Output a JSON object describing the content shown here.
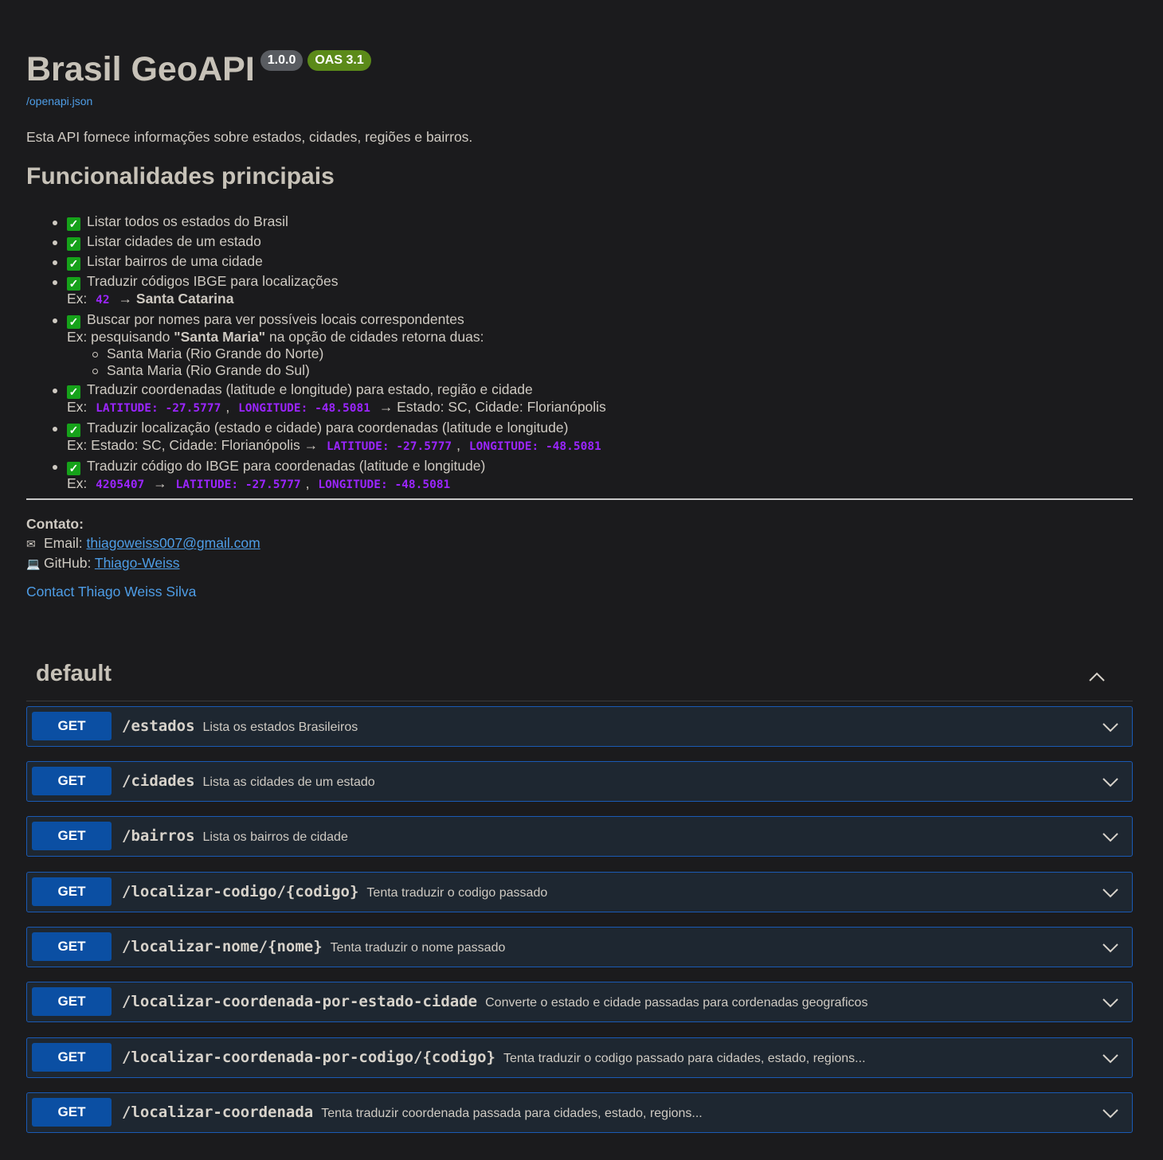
{
  "info": {
    "title": "Brasil GeoAPI",
    "version": "1.0.0",
    "oas": "OAS 3.1",
    "spec_link": "/openapi.json",
    "description": "Esta API fornece informações sobre estados, cidades, regiões e bairros."
  },
  "features": {
    "heading": "Funcionalidades principais",
    "items": [
      {
        "text": "Listar todos os estados do Brasil"
      },
      {
        "text": "Listar cidades de um estado"
      },
      {
        "text": "Listar bairros de uma cidade"
      },
      {
        "text": "Traduzir códigos IBGE para localizações",
        "ex_prefix": "Ex:",
        "ex_code": "42",
        "ex_arrow": "→",
        "ex_result": "Santa Catarina"
      },
      {
        "text": "Buscar por nomes para ver possíveis locais correspondentes",
        "ex_prefix": "Ex: pesquisando",
        "ex_term": "\"Santa Maria\"",
        "ex_suffix": "na opção de cidades retorna duas:",
        "subitems": [
          "Santa Maria (Rio Grande do Norte)",
          "Santa Maria (Rio Grande do Sul)"
        ]
      },
      {
        "text": "Traduzir coordenadas (latitude e longitude) para estado, região e cidade",
        "ex_prefix": "Ex:",
        "ex_lat": "LATITUDE: -27.5777",
        "ex_comma": ",",
        "ex_lon": "LONGITUDE: -48.5081",
        "ex_result": "→ Estado: SC, Cidade: Florianópolis"
      },
      {
        "text": "Traduzir localização (estado e cidade) para coordenadas (latitude e longitude)",
        "ex_prefix": "Ex: Estado: SC, Cidade: Florianópolis →",
        "ex_lat": "LATITUDE: -27.5777",
        "ex_comma": ",",
        "ex_lon": "LONGITUDE: -48.5081"
      },
      {
        "text": "Traduzir código do IBGE para coordenadas (latitude e longitude)",
        "ex_prefix": "Ex:",
        "ex_code": "4205407",
        "ex_arrow": "→",
        "ex_lat": "LATITUDE: -27.5777",
        "ex_comma": ",",
        "ex_lon": "LONGITUDE: -48.5081"
      }
    ]
  },
  "contact": {
    "heading": "Contato:",
    "email_label": "Email:",
    "email": "thiagoweiss007@gmail.com",
    "github_label": "GitHub:",
    "github": "Thiago-Weiss",
    "contact_link": "Contact Thiago Weiss Silva"
  },
  "section": {
    "name": "default"
  },
  "operations": [
    {
      "method": "GET",
      "path": "/estados",
      "summary": "Lista os estados Brasileiros"
    },
    {
      "method": "GET",
      "path": "/cidades",
      "summary": "Lista as cidades de um estado"
    },
    {
      "method": "GET",
      "path": "/bairros",
      "summary": "Lista os bairros de cidade"
    },
    {
      "method": "GET",
      "path": "/localizar-codigo/{codigo}",
      "summary": "Tenta traduzir o codigo passado"
    },
    {
      "method": "GET",
      "path": "/localizar-nome/{nome}",
      "summary": "Tenta traduzir o nome passado"
    },
    {
      "method": "GET",
      "path": "/localizar-coordenada-por-estado-cidade",
      "summary": "Converte o estado e cidade passadas para cordenadas geograficos"
    },
    {
      "method": "GET",
      "path": "/localizar-coordenada-por-codigo/{codigo}",
      "summary": "Tenta traduzir o codigo passado para cidades, estado, regions..."
    },
    {
      "method": "GET",
      "path": "/localizar-coordenada",
      "summary": "Tenta traduzir coordenada passada para cidades, estado, regions..."
    }
  ],
  "colors": {
    "get": "#0b4fa3",
    "border": "#1a5ab5",
    "code": "#9b25ff",
    "link": "#4e9de6"
  }
}
